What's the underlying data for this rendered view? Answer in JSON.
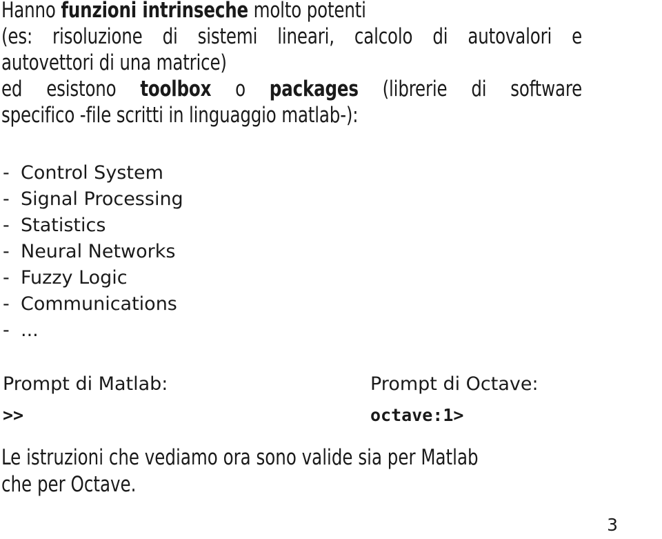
{
  "page": {
    "number": "3",
    "background_color": "#ffffff",
    "text_color": "#1a1a1a"
  },
  "intro": {
    "lines": [
      {
        "justified": false,
        "segments": [
          {
            "text": "Hanno ",
            "bold": false
          },
          {
            "text": "funzioni intrinseche",
            "bold": true
          },
          {
            "text": " molto potenti",
            "bold": false
          }
        ]
      },
      {
        "justified": true,
        "words": [
          "(es:",
          "risoluzione",
          "di",
          "sistemi",
          "lineari,",
          "calcolo",
          "di",
          "autovalori",
          "e"
        ]
      },
      {
        "justified": false,
        "segments": [
          {
            "text": "autovettori di una matrice)",
            "bold": false
          }
        ]
      },
      {
        "justified": true,
        "words": [
          "ed",
          "esistono",
          "<b>toolbox</b>",
          "o",
          "<b>packages</b>",
          "(librerie",
          "di",
          "software"
        ]
      },
      {
        "justified": false,
        "segments": [
          {
            "text": "specifico -file scritti in linguaggio matlab-):",
            "bold": false
          }
        ]
      }
    ],
    "plain_text": "Hanno funzioni intrinseche molto potenti (es: risoluzione di sistemi lineari, calcolo di autovalori e autovettori di una matrice) ed esistono toolbox o packages (librerie di software specifico -file scritti in linguaggio matlab-):"
  },
  "toolbox_list": {
    "bullet": "-",
    "items": [
      "Control System",
      "Signal Processing",
      "Statistics",
      "Neural Networks",
      "Fuzzy Logic",
      "Communications",
      "..."
    ]
  },
  "prompts": [
    {
      "label": "Prompt di Matlab:",
      "value": ">>"
    },
    {
      "label": "Prompt di Octave:",
      "value": "octave:1>"
    }
  ],
  "outro": {
    "lines": [
      "Le istruzioni che vediamo ora sono valide sia per Matlab",
      "che per Octave."
    ]
  }
}
